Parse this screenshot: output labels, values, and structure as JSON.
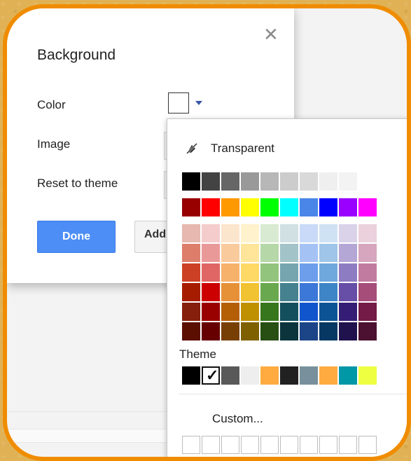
{
  "dialog": {
    "title": "Background",
    "close_glyph": "✕",
    "rows": {
      "color_label": "Color",
      "image_label": "Image",
      "reset_label": "Reset to theme"
    },
    "selected_color": "#ffffff",
    "done_label": "Done",
    "add_label": "Add"
  },
  "picker": {
    "transparent_label": "Transparent",
    "transparent_icon": "paint-bucket-slash-icon",
    "grays": [
      "#000000",
      "#434343",
      "#666666",
      "#999999",
      "#b7b7b7",
      "#cccccc",
      "#d9d9d9",
      "#efefef",
      "#f3f3f3",
      "#ffffff"
    ],
    "brights": [
      "#980000",
      "#ff0000",
      "#ff9900",
      "#ffff00",
      "#00ff00",
      "#00ffff",
      "#4a86e8",
      "#0000ff",
      "#9900ff",
      "#ff00ff"
    ],
    "shades": [
      [
        "#e6b8af",
        "#f4cccc",
        "#fce5cd",
        "#fff2cc",
        "#d9ead3",
        "#d0e0e3",
        "#c9daf8",
        "#cfe2f3",
        "#d9d2e9",
        "#ead1dc"
      ],
      [
        "#dd7e6b",
        "#ea9999",
        "#f9cb9c",
        "#ffe599",
        "#b6d7a8",
        "#a2c4c9",
        "#a4c2f4",
        "#9fc5e8",
        "#b4a7d6",
        "#d5a6bd"
      ],
      [
        "#cc4125",
        "#e06666",
        "#f6b26b",
        "#ffd966",
        "#93c47d",
        "#76a5af",
        "#6d9eeb",
        "#6fa8dc",
        "#8e7cc3",
        "#c27ba0"
      ],
      [
        "#a61c00",
        "#cc0000",
        "#e69138",
        "#f1c232",
        "#6aa84f",
        "#45818e",
        "#3c78d8",
        "#3d85c6",
        "#674ea7",
        "#a64d79"
      ],
      [
        "#85200c",
        "#990000",
        "#b45f06",
        "#bf9000",
        "#38761d",
        "#134f5c",
        "#1155cc",
        "#0b5394",
        "#351c75",
        "#741b47"
      ],
      [
        "#5b0f00",
        "#660000",
        "#783f04",
        "#7f6000",
        "#274e13",
        "#0c343d",
        "#1c4587",
        "#073763",
        "#20124d",
        "#4c1130"
      ]
    ],
    "theme_label": "Theme",
    "theme_colors": [
      "#000000",
      "#ffffff",
      "#595959",
      "#eeeeee",
      "#ffab40",
      "#212121",
      "#78909c",
      "#ffab40",
      "#0097a7",
      "#eeff41"
    ],
    "theme_selected_index": 1,
    "checkmark": "✓",
    "custom_label": "Custom..."
  }
}
